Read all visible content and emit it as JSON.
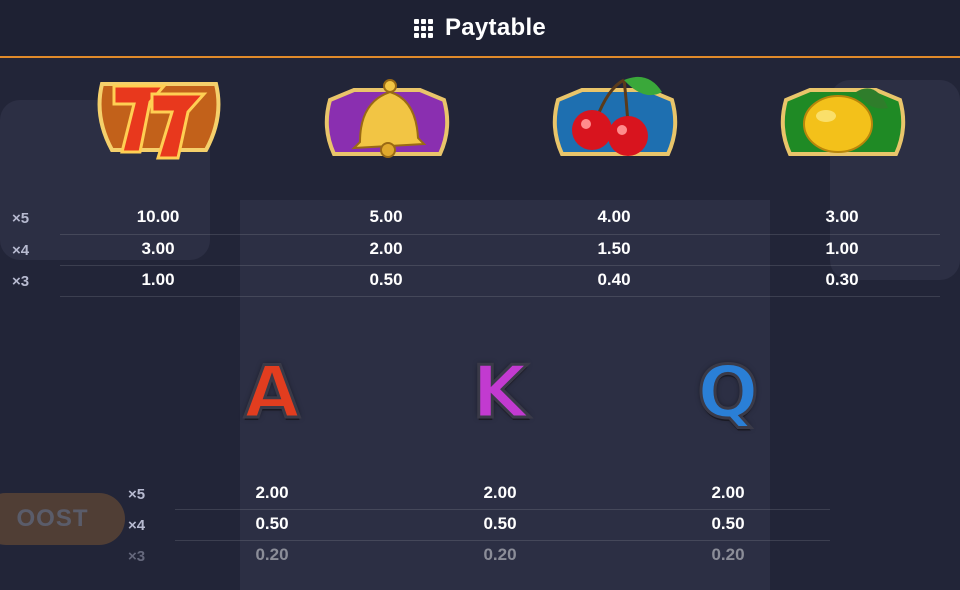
{
  "header": {
    "title": "Paytable",
    "icon": "grid-icon"
  },
  "symbols_top": [
    {
      "name": "seven",
      "pays": [
        "10.00",
        "3.00",
        "1.00"
      ]
    },
    {
      "name": "bell",
      "pays": [
        "5.00",
        "2.00",
        "0.50"
      ]
    },
    {
      "name": "cherry",
      "pays": [
        "4.00",
        "1.50",
        "0.40"
      ]
    },
    {
      "name": "lemon",
      "pays": [
        "3.00",
        "1.00",
        "0.30"
      ]
    }
  ],
  "symbols_bottom": [
    {
      "letter": "A",
      "color": "#e23d1f",
      "pays": [
        "2.00",
        "0.50",
        "0.20"
      ]
    },
    {
      "letter": "K",
      "color": "#c23ad0",
      "pays": [
        "2.00",
        "0.50",
        "0.20"
      ]
    },
    {
      "letter": "Q",
      "color": "#2a7fd6",
      "pays": [
        "2.00",
        "0.50",
        "0.20"
      ]
    }
  ],
  "multipliers": [
    "×5",
    "×4",
    "×3"
  ],
  "colors": {
    "accent": "#e08a2a",
    "background": "#222538"
  }
}
